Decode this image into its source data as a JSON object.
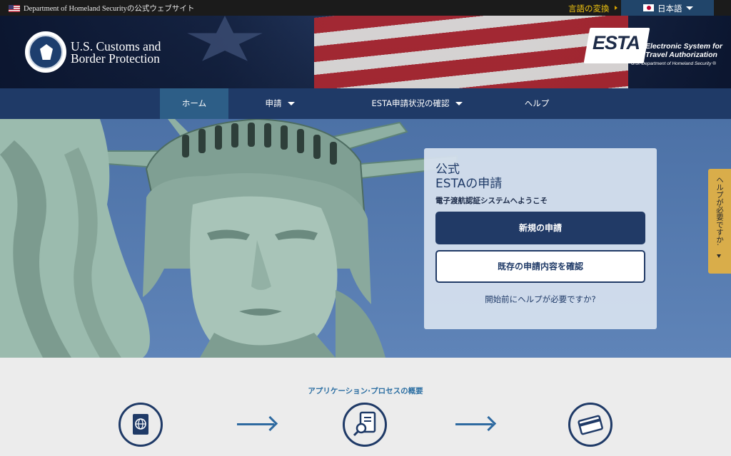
{
  "gov_bar": {
    "text": "Department of Homeland Securityの公式ウェブサイト",
    "language_label": "言語の変換",
    "language_selected": "日本語"
  },
  "header": {
    "agency_line1": "U.S. Customs and",
    "agency_line2": "Border Protection",
    "esta_wordmark": "ESTA",
    "esta_tagline_line1": "Electronic System for",
    "esta_tagline_line2": "Travel Authorization",
    "esta_subline": "U.S. Department of Homeland Security ®"
  },
  "nav": {
    "items": [
      {
        "label": "ホーム",
        "active": true,
        "dropdown": false
      },
      {
        "label": "申請",
        "active": false,
        "dropdown": true
      },
      {
        "label": "ESTA申請状況の確認",
        "active": false,
        "dropdown": true
      },
      {
        "label": "ヘルプ",
        "active": false,
        "dropdown": false
      }
    ]
  },
  "card": {
    "eyebrow": "公式",
    "title": "ESTAの申請",
    "welcome": "電子渡航認証システムへようこそ",
    "primary_button": "新規の申請",
    "secondary_button": "既存の申請内容を確認",
    "help_link": "開始前にヘルプが必要ですか?"
  },
  "help_tab": {
    "label": "ヘルプが必要ですか."
  },
  "process": {
    "title": "アプリケーション·プロセスの概要",
    "steps": [
      {
        "icon": "passport-icon"
      },
      {
        "icon": "document-search-icon"
      },
      {
        "icon": "credit-card-icon"
      }
    ]
  },
  "colors": {
    "nav_background": "#1f3a67",
    "nav_active": "#2d5e87",
    "primary_button": "#213a66",
    "accent_gold": "#f1c40f",
    "help_tab": "#d9ad4a",
    "process_accent": "#2e6aa0"
  }
}
